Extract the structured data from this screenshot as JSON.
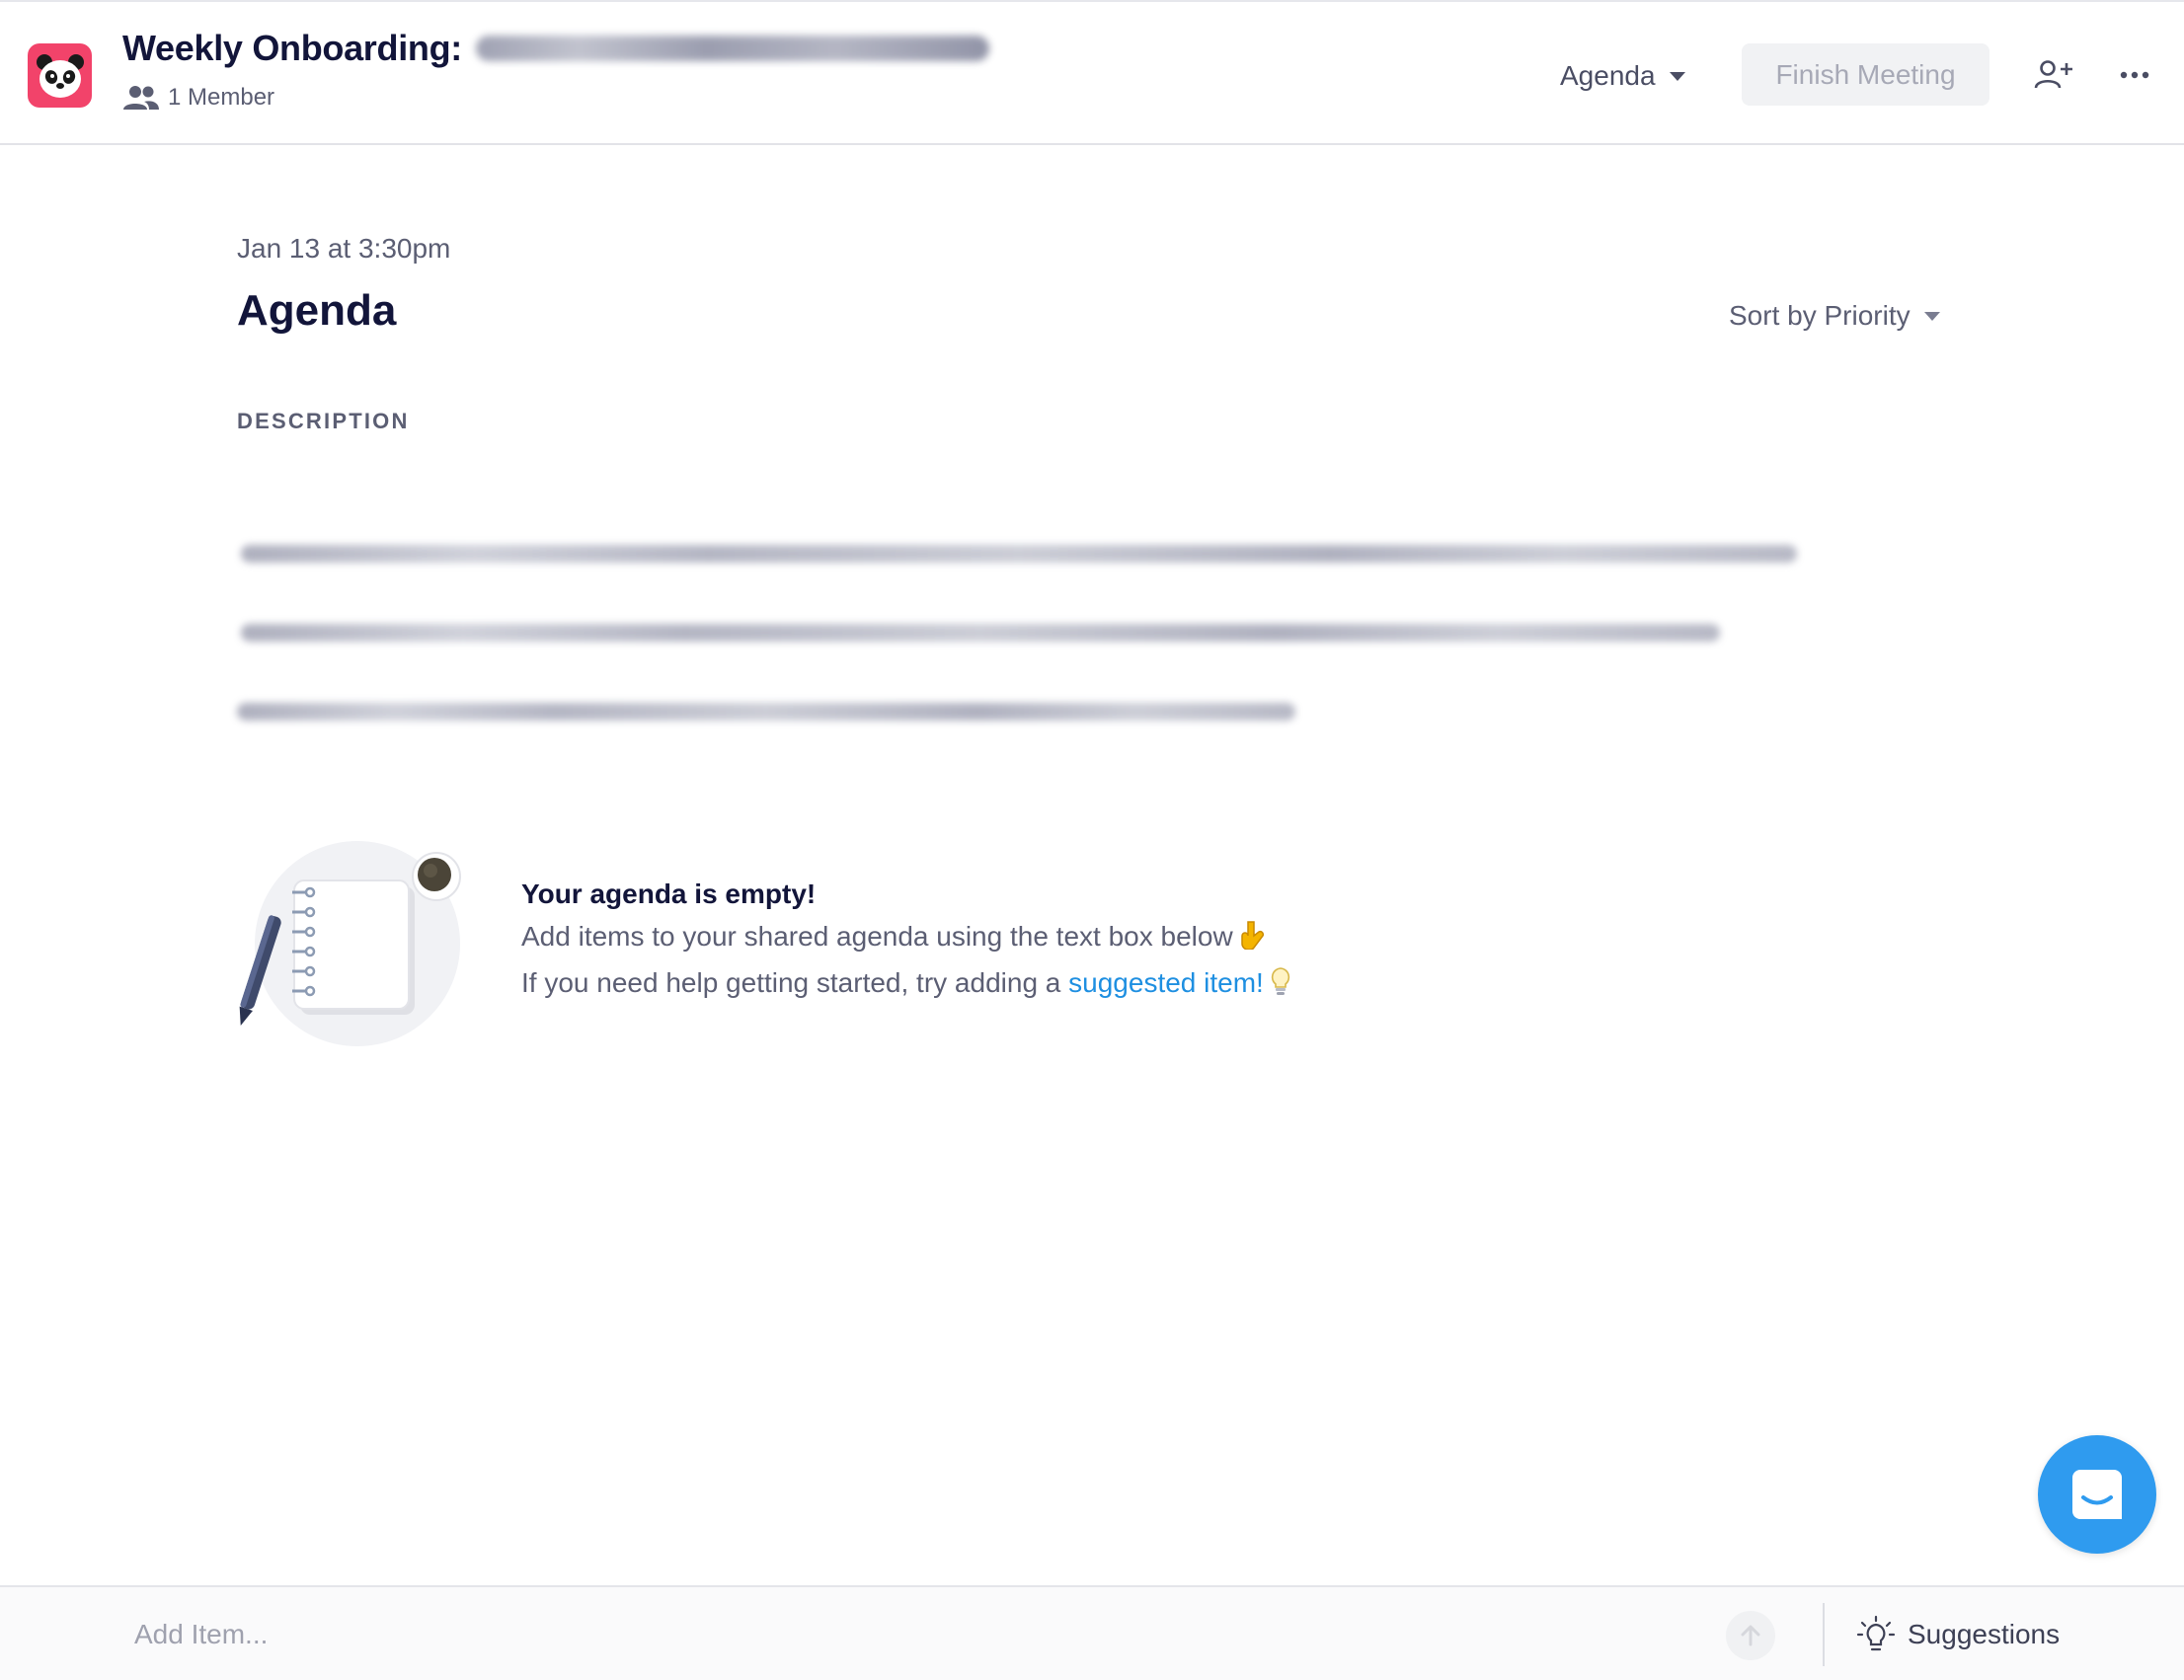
{
  "header": {
    "app_icon": "panda-icon",
    "meeting_title": "Weekly Onboarding:",
    "members_label": "1 Member",
    "members_icon": "members-icon",
    "agenda_menu_label": "Agenda",
    "finish_meeting_label": "Finish Meeting",
    "add_member_icon": "add-member-icon",
    "more_icon": "more-options-icon"
  },
  "main": {
    "meeting_date": "Jan 13 at 3:30pm",
    "page_title": "Agenda",
    "sort_label": "Sort by Priority",
    "description_label": "DESCRIPTION"
  },
  "empty_state": {
    "heading": "Your agenda is empty!",
    "line1": "Add items to your shared agenda using the text box below",
    "line2_prefix": "If you need help getting started, try adding a",
    "line2_link": "suggested item!",
    "illustration": "notebook-illustration",
    "pointing_icon": "pointing-down-icon",
    "lightbulb_icon": "lightbulb-icon"
  },
  "bottom_bar": {
    "add_item_placeholder": "Add Item...",
    "suggestions_label": "Suggestions",
    "submit_icon": "arrow-up-icon",
    "suggestions_icon": "lightbulb-icon"
  },
  "colors": {
    "accent": "#2f9bef",
    "link": "#1e8fe1",
    "app_icon_bg": "#f2436a",
    "title": "#12153a",
    "muted": "#5b5e73"
  }
}
